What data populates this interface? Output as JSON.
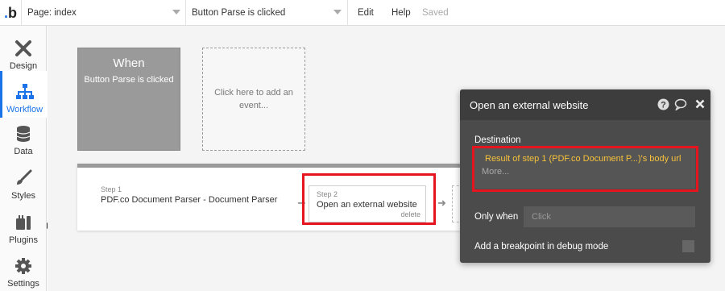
{
  "topbar": {
    "logo": "b",
    "page_select": "Page: index",
    "event_select": "Button Parse is clicked",
    "edit": "Edit",
    "help": "Help",
    "status": "Saved"
  },
  "sidebar": {
    "items": [
      {
        "label": "Design",
        "icon": "design-icon",
        "active": false
      },
      {
        "label": "Workflow",
        "icon": "workflow-icon",
        "active": true
      },
      {
        "label": "Data",
        "icon": "database-icon",
        "active": false
      },
      {
        "label": "Styles",
        "icon": "brush-icon",
        "active": false
      },
      {
        "label": "Plugins",
        "icon": "plug-icon",
        "active": false
      },
      {
        "label": "Settings",
        "icon": "gear-icon",
        "active": false
      }
    ]
  },
  "canvas": {
    "when_card": {
      "title": "When",
      "subtitle": "Button Parse is clicked"
    },
    "add_event": "Click here to add an event..."
  },
  "steps": [
    {
      "label": "Step 1",
      "name": "PDF.co Document Parser - Document Parser"
    },
    {
      "label": "Step 2",
      "name": "Open an external website",
      "delete": "delete"
    }
  ],
  "panel": {
    "title": "Open an external website",
    "destination_label": "Destination",
    "destination_value": "Result of step 1 (PDF.co Document P...)'s body url",
    "more": "More...",
    "only_when_label": "Only when",
    "only_when_placeholder": "Click",
    "breakpoint_label": "Add a breakpoint in debug mode"
  },
  "colors": {
    "accent": "#1a73e8",
    "highlight": "#e5141e",
    "dynamic_text": "#f7c13a",
    "panel_bg": "#4b4b4b"
  }
}
